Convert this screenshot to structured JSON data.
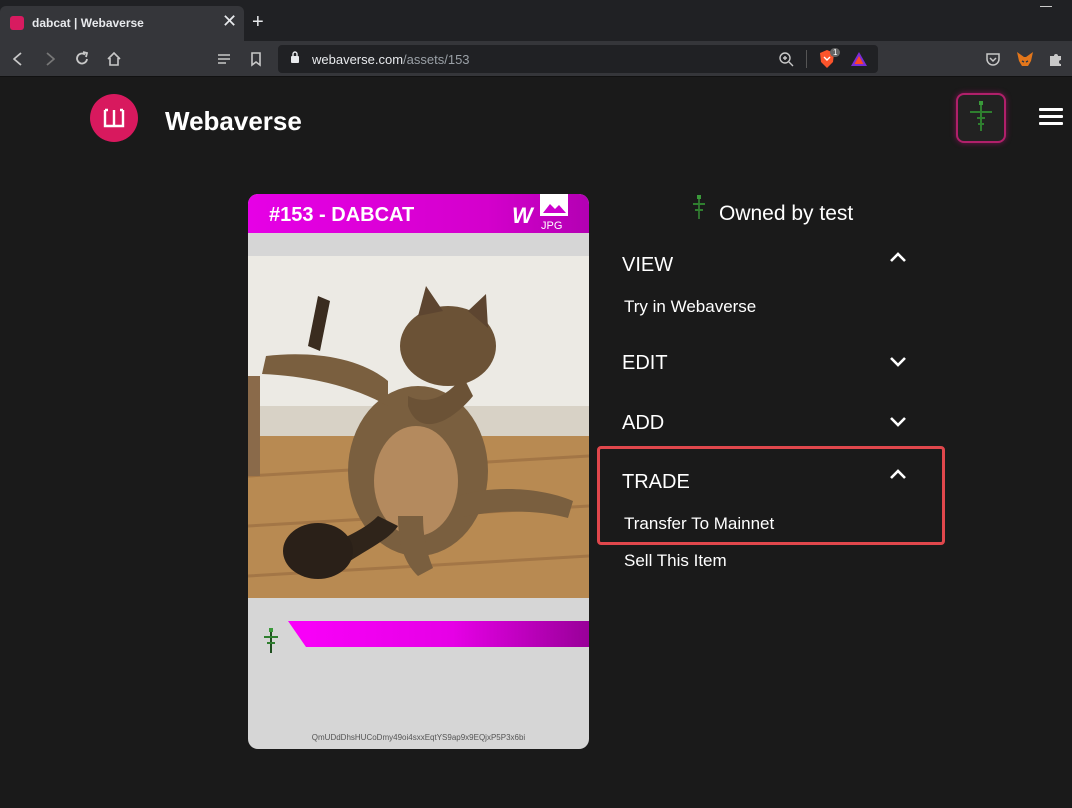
{
  "browser": {
    "tab_title": "dabcat | Webaverse",
    "tab_close": "✕",
    "new_tab": "+",
    "url_domain": "webaverse.com",
    "url_path": "/assets/153",
    "brave_badge_count": "1"
  },
  "header": {
    "brand": "Webaverse"
  },
  "card": {
    "title": "#153 - DABCAT",
    "logo_letter": "W",
    "file_type": "JPG",
    "hash": "QmUDdDhsHUCoDmy49oi4sxxEqtYS9ap9x9EQjxP5P3x6bi",
    "accent_color": "#e600e6"
  },
  "panel": {
    "owner_text": "Owned by test",
    "sections": [
      {
        "title": "VIEW",
        "expanded": true,
        "items": [
          "Try in Webaverse"
        ]
      },
      {
        "title": "EDIT",
        "expanded": false,
        "items": []
      },
      {
        "title": "ADD",
        "expanded": false,
        "items": []
      },
      {
        "title": "TRADE",
        "expanded": true,
        "items": [
          "Transfer To Mainnet",
          "Sell This Item"
        ]
      }
    ]
  },
  "colors": {
    "brand": "#d8195e",
    "highlight": "#e0474c"
  }
}
